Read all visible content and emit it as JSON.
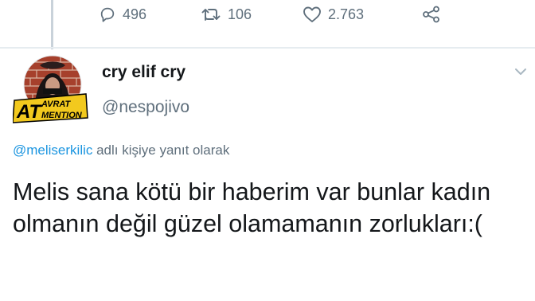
{
  "actions": {
    "reply_count": "496",
    "retweet_count": "106",
    "like_count": "2.763"
  },
  "user": {
    "display_name": "cry elif cry",
    "handle": "@nespojivo",
    "avatar_badge_top": "AVRAT",
    "avatar_badge_left": "AT",
    "avatar_badge_bottom": "MENTION"
  },
  "reply_context": {
    "mention": "@meliserkilic",
    "suffix": " adlı kişiye yanıt olarak"
  },
  "tweet": {
    "text": "Melis sana kötü bir haberim var bunlar kadın olmanın değil güzel olamamanın zorlukları:("
  },
  "colors": {
    "text": "#14171a",
    "secondary": "#5f6f7c",
    "link": "#1b95e0",
    "divider": "#e6ecf0",
    "badge": "#f2c91e"
  },
  "icons": [
    "reply-icon",
    "retweet-icon",
    "like-icon",
    "share-icon",
    "chevron-down-icon"
  ]
}
